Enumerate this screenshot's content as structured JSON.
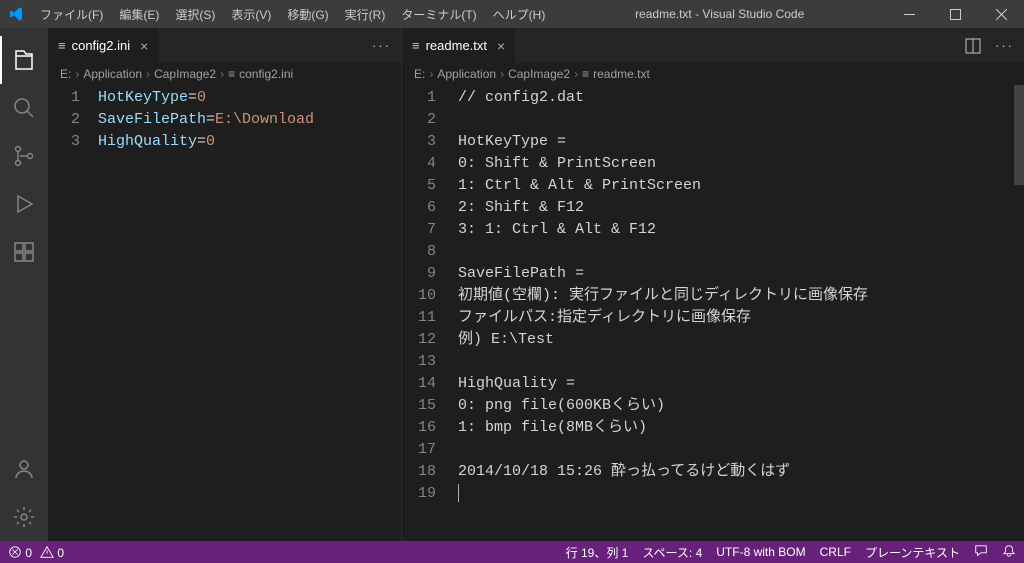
{
  "titlebar": {
    "menus": [
      "ファイル(F)",
      "編集(E)",
      "選択(S)",
      "表示(V)",
      "移動(G)",
      "実行(R)",
      "ターミナル(T)",
      "ヘルプ(H)"
    ],
    "app_title": "readme.txt - Visual Studio Code"
  },
  "left_editor": {
    "tab_label": "config2.ini",
    "breadcrumbs": [
      "E:",
      "Application",
      "CapImage2",
      "config2.ini"
    ],
    "lines": [
      {
        "n": "1",
        "tokens": [
          [
            "key",
            "HotKeyType"
          ],
          [
            "op",
            "="
          ],
          [
            "val",
            "0"
          ]
        ]
      },
      {
        "n": "2",
        "tokens": [
          [
            "key",
            "SaveFilePath"
          ],
          [
            "op",
            "="
          ],
          [
            "val",
            "E:\\Download"
          ]
        ]
      },
      {
        "n": "3",
        "tokens": [
          [
            "key",
            "HighQuality"
          ],
          [
            "op",
            "="
          ],
          [
            "val",
            "0"
          ]
        ]
      }
    ]
  },
  "right_editor": {
    "tab_label": "readme.txt",
    "breadcrumbs": [
      "E:",
      "Application",
      "CapImage2",
      "readme.txt"
    ],
    "lines": [
      {
        "n": "1",
        "text": "// config2.dat"
      },
      {
        "n": "2",
        "text": ""
      },
      {
        "n": "3",
        "text": "HotKeyType ="
      },
      {
        "n": "4",
        "text": "0: Shift & PrintScreen"
      },
      {
        "n": "5",
        "text": "1: Ctrl & Alt & PrintScreen"
      },
      {
        "n": "6",
        "text": "2: Shift & F12"
      },
      {
        "n": "7",
        "text": "3: 1: Ctrl & Alt & F12"
      },
      {
        "n": "8",
        "text": ""
      },
      {
        "n": "9",
        "text": "SaveFilePath ="
      },
      {
        "n": "10",
        "text": "初期値(空欄): 実行ファイルと同じディレクトリに画像保存"
      },
      {
        "n": "11",
        "text": "ファイルパス:指定ディレクトリに画像保存"
      },
      {
        "n": "12",
        "text": "例) E:\\Test"
      },
      {
        "n": "13",
        "text": ""
      },
      {
        "n": "14",
        "text": "HighQuality ="
      },
      {
        "n": "15",
        "text": "0: png file(600KBくらい)"
      },
      {
        "n": "16",
        "text": "1: bmp file(8MBくらい)"
      },
      {
        "n": "17",
        "text": ""
      },
      {
        "n": "18",
        "text": "2014/10/18 15:26 酔っ払ってるけど動くはず"
      },
      {
        "n": "19",
        "text": ""
      }
    ]
  },
  "statusbar": {
    "errors": "0",
    "warnings": "0",
    "line_col": "行 19、列 1",
    "spaces": "スペース: 4",
    "encoding": "UTF-8 with BOM",
    "eol": "CRLF",
    "lang": "プレーンテキスト"
  }
}
